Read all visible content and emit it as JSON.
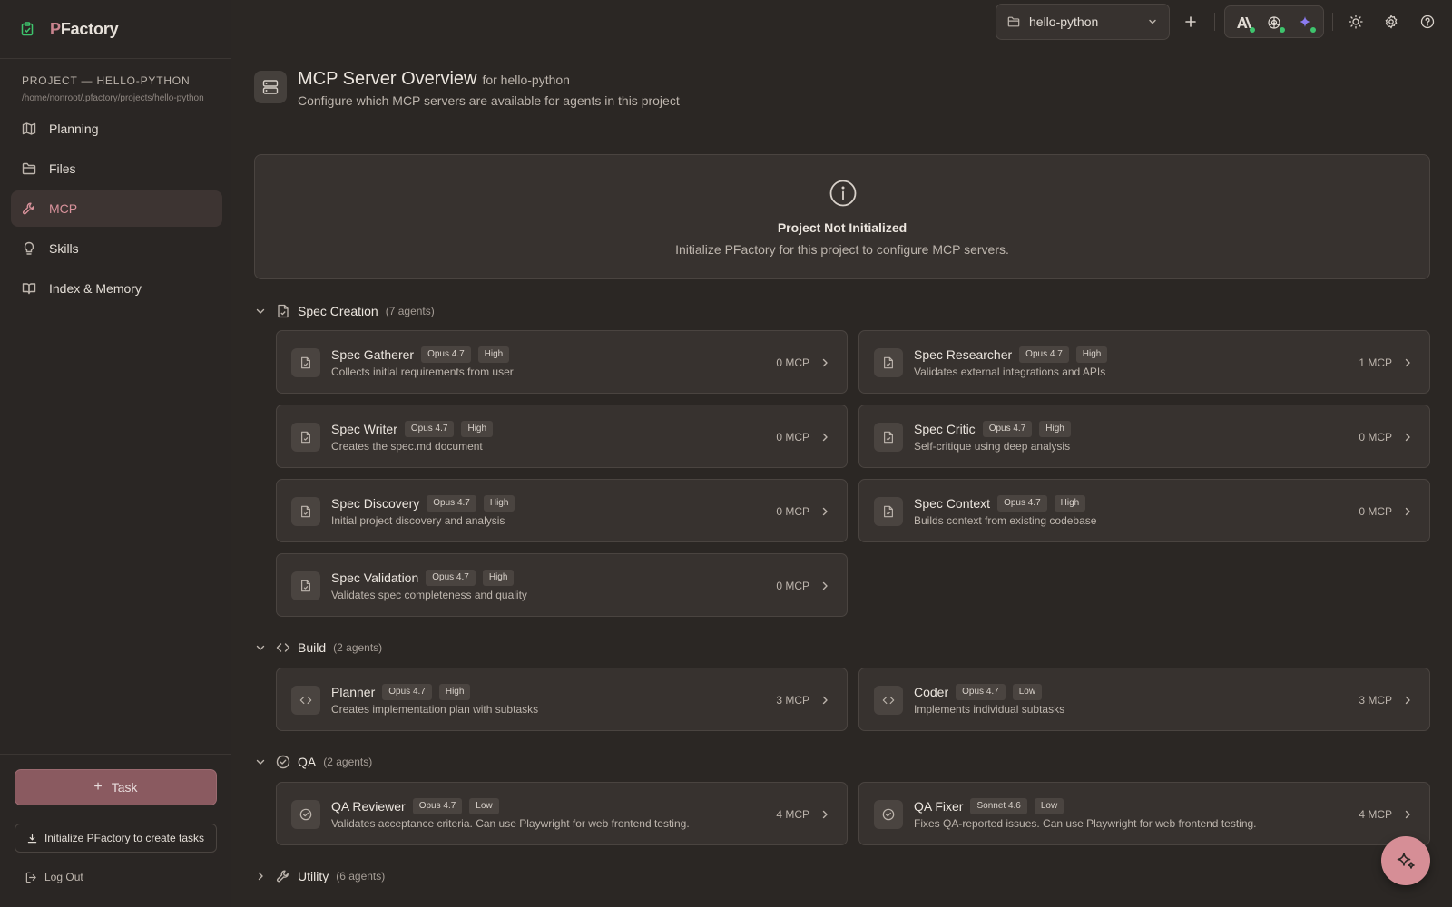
{
  "app": {
    "logo_p": "P",
    "logo_rest": "Factory"
  },
  "sidebar": {
    "project_label": "PROJECT — HELLO-PYTHON",
    "project_path": "/home/nonroot/.pfactory/projects/hello-python",
    "items": [
      {
        "label": "Planning",
        "icon": "map-icon",
        "active": false
      },
      {
        "label": "Files",
        "icon": "folder-icon",
        "active": false
      },
      {
        "label": "MCP",
        "icon": "wrench-icon",
        "active": true
      },
      {
        "label": "Skills",
        "icon": "lightbulb-icon",
        "active": false
      },
      {
        "label": "Index & Memory",
        "icon": "book-icon",
        "active": false
      }
    ],
    "task_button": "Task",
    "init_button": "Initialize PFactory to create tasks",
    "logout": "Log Out"
  },
  "topbar": {
    "project_select": "hello-python"
  },
  "header": {
    "title": "MCP Server Overview",
    "for_label": "for hello-python",
    "subtitle": "Configure which MCP servers are available for agents in this project"
  },
  "notice": {
    "title": "Project Not Initialized",
    "text": "Initialize PFactory for this project to configure MCP servers."
  },
  "sections": [
    {
      "name": "Spec Creation",
      "count": "(7 agents)",
      "expanded": true,
      "agents": [
        {
          "name": "Spec Gatherer",
          "model": "Opus 4.7",
          "level": "High",
          "desc": "Collects initial requirements from user",
          "mcp": "0 MCP"
        },
        {
          "name": "Spec Researcher",
          "model": "Opus 4.7",
          "level": "High",
          "desc": "Validates external integrations and APIs",
          "mcp": "1 MCP"
        },
        {
          "name": "Spec Writer",
          "model": "Opus 4.7",
          "level": "High",
          "desc": "Creates the spec.md document",
          "mcp": "0 MCP"
        },
        {
          "name": "Spec Critic",
          "model": "Opus 4.7",
          "level": "High",
          "desc": "Self-critique using deep analysis",
          "mcp": "0 MCP"
        },
        {
          "name": "Spec Discovery",
          "model": "Opus 4.7",
          "level": "High",
          "desc": "Initial project discovery and analysis",
          "mcp": "0 MCP"
        },
        {
          "name": "Spec Context",
          "model": "Opus 4.7",
          "level": "High",
          "desc": "Builds context from existing codebase",
          "mcp": "0 MCP"
        },
        {
          "name": "Spec Validation",
          "model": "Opus 4.7",
          "level": "High",
          "desc": "Validates spec completeness and quality",
          "mcp": "0 MCP"
        }
      ]
    },
    {
      "name": "Build",
      "count": "(2 agents)",
      "expanded": true,
      "agents": [
        {
          "name": "Planner",
          "model": "Opus 4.7",
          "level": "High",
          "desc": "Creates implementation plan with subtasks",
          "mcp": "3 MCP"
        },
        {
          "name": "Coder",
          "model": "Opus 4.7",
          "level": "Low",
          "desc": "Implements individual subtasks",
          "mcp": "3 MCP"
        }
      ]
    },
    {
      "name": "QA",
      "count": "(2 agents)",
      "expanded": true,
      "agents": [
        {
          "name": "QA Reviewer",
          "model": "Opus 4.7",
          "level": "Low",
          "desc": "Validates acceptance criteria. Can use Playwright for web frontend testing.",
          "mcp": "4 MCP"
        },
        {
          "name": "QA Fixer",
          "model": "Sonnet 4.6",
          "level": "Low",
          "desc": "Fixes QA-reported issues. Can use Playwright for web frontend testing.",
          "mcp": "4 MCP"
        }
      ]
    },
    {
      "name": "Utility",
      "count": "(6 agents)",
      "expanded": false,
      "agents": []
    }
  ],
  "colors": {
    "accent": "#d68e96",
    "bg": "#2b2724",
    "card": "#37322f",
    "status_ok": "#3ec46d"
  }
}
